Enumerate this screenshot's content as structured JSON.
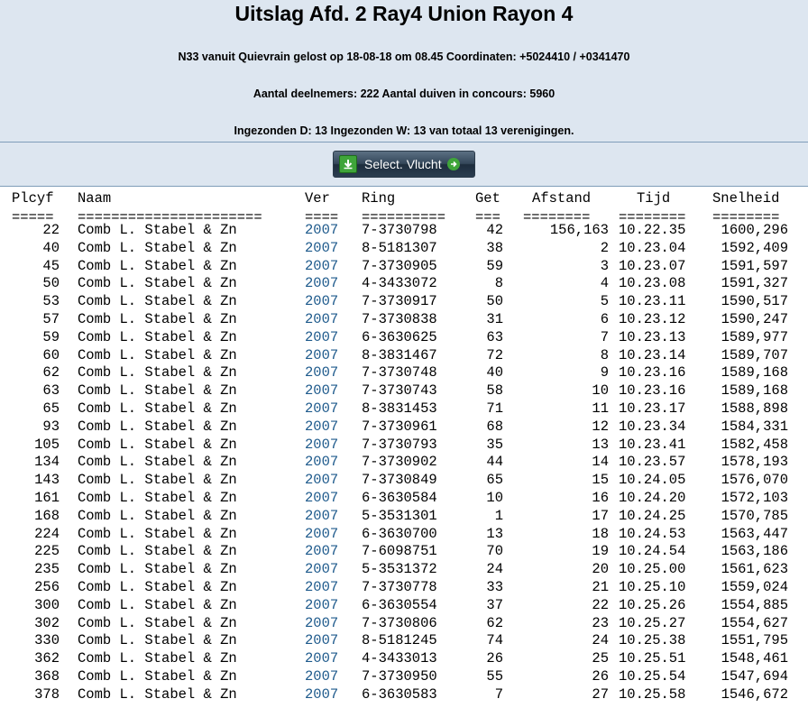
{
  "header": {
    "title": "Uitslag Afd. 2 Ray4 Union Rayon 4",
    "line1": "N33 vanuit Quievrain gelost op 18-08-18 om 08.45 Coordinaten: +5024410 / +0341470",
    "line2": "Aantal deelnemers: 222 Aantal duiven in concours: 5960",
    "line3": "Ingezonden D: 13 Ingezonden W: 13 van totaal 13 verenigingen."
  },
  "select_button": {
    "label": "Select. Vlucht",
    "left_icon": "download-icon",
    "right_icon": "arrow-right-icon"
  },
  "colors": {
    "header_bg": "#dde6f0",
    "link": "#1e5a8c",
    "border": "#7f9db9"
  },
  "table": {
    "columns": {
      "plcyf": "Plcyf",
      "naam": "Naam",
      "ver": "Ver",
      "ring": "Ring",
      "get": "Get",
      "afstand": "Afstand",
      "tijd": "Tijd",
      "snelheid": "Snelheid"
    },
    "separators": {
      "plcyf": "=====",
      "naam": "======================",
      "ver": "====",
      "ring": "==========",
      "get": "===",
      "afstand": "========",
      "tijd": "========",
      "snelheid": "========"
    },
    "rows": [
      {
        "plcyf": "22",
        "naam": "Comb L. Stabel & Zn",
        "ver": "2007",
        "ring": "7-3730798",
        "get": "42",
        "afstand": "156,163",
        "tijd": "10.22.35",
        "snelheid": "1600,296"
      },
      {
        "plcyf": "40",
        "naam": "Comb L. Stabel & Zn",
        "ver": "2007",
        "ring": "8-5181307",
        "get": "38",
        "afstand": "2",
        "tijd": "10.23.04",
        "snelheid": "1592,409"
      },
      {
        "plcyf": "45",
        "naam": "Comb L. Stabel & Zn",
        "ver": "2007",
        "ring": "7-3730905",
        "get": "59",
        "afstand": "3",
        "tijd": "10.23.07",
        "snelheid": "1591,597"
      },
      {
        "plcyf": "50",
        "naam": "Comb L. Stabel & Zn",
        "ver": "2007",
        "ring": "4-3433072",
        "get": "8",
        "afstand": "4",
        "tijd": "10.23.08",
        "snelheid": "1591,327"
      },
      {
        "plcyf": "53",
        "naam": "Comb L. Stabel & Zn",
        "ver": "2007",
        "ring": "7-3730917",
        "get": "50",
        "afstand": "5",
        "tijd": "10.23.11",
        "snelheid": "1590,517"
      },
      {
        "plcyf": "57",
        "naam": "Comb L. Stabel & Zn",
        "ver": "2007",
        "ring": "7-3730838",
        "get": "31",
        "afstand": "6",
        "tijd": "10.23.12",
        "snelheid": "1590,247"
      },
      {
        "plcyf": "59",
        "naam": "Comb L. Stabel & Zn",
        "ver": "2007",
        "ring": "6-3630625",
        "get": "63",
        "afstand": "7",
        "tijd": "10.23.13",
        "snelheid": "1589,977"
      },
      {
        "plcyf": "60",
        "naam": "Comb L. Stabel & Zn",
        "ver": "2007",
        "ring": "8-3831467",
        "get": "72",
        "afstand": "8",
        "tijd": "10.23.14",
        "snelheid": "1589,707"
      },
      {
        "plcyf": "62",
        "naam": "Comb L. Stabel & Zn",
        "ver": "2007",
        "ring": "7-3730748",
        "get": "40",
        "afstand": "9",
        "tijd": "10.23.16",
        "snelheid": "1589,168"
      },
      {
        "plcyf": "63",
        "naam": "Comb L. Stabel & Zn",
        "ver": "2007",
        "ring": "7-3730743",
        "get": "58",
        "afstand": "10",
        "tijd": "10.23.16",
        "snelheid": "1589,168"
      },
      {
        "plcyf": "65",
        "naam": "Comb L. Stabel & Zn",
        "ver": "2007",
        "ring": "8-3831453",
        "get": "71",
        "afstand": "11",
        "tijd": "10.23.17",
        "snelheid": "1588,898"
      },
      {
        "plcyf": "93",
        "naam": "Comb L. Stabel & Zn",
        "ver": "2007",
        "ring": "7-3730961",
        "get": "68",
        "afstand": "12",
        "tijd": "10.23.34",
        "snelheid": "1584,331"
      },
      {
        "plcyf": "105",
        "naam": "Comb L. Stabel & Zn",
        "ver": "2007",
        "ring": "7-3730793",
        "get": "35",
        "afstand": "13",
        "tijd": "10.23.41",
        "snelheid": "1582,458"
      },
      {
        "plcyf": "134",
        "naam": "Comb L. Stabel & Zn",
        "ver": "2007",
        "ring": "7-3730902",
        "get": "44",
        "afstand": "14",
        "tijd": "10.23.57",
        "snelheid": "1578,193"
      },
      {
        "plcyf": "143",
        "naam": "Comb L. Stabel & Zn",
        "ver": "2007",
        "ring": "7-3730849",
        "get": "65",
        "afstand": "15",
        "tijd": "10.24.05",
        "snelheid": "1576,070"
      },
      {
        "plcyf": "161",
        "naam": "Comb L. Stabel & Zn",
        "ver": "2007",
        "ring": "6-3630584",
        "get": "10",
        "afstand": "16",
        "tijd": "10.24.20",
        "snelheid": "1572,103"
      },
      {
        "plcyf": "168",
        "naam": "Comb L. Stabel & Zn",
        "ver": "2007",
        "ring": "5-3531301",
        "get": "1",
        "afstand": "17",
        "tijd": "10.24.25",
        "snelheid": "1570,785"
      },
      {
        "plcyf": "224",
        "naam": "Comb L. Stabel & Zn",
        "ver": "2007",
        "ring": "6-3630700",
        "get": "13",
        "afstand": "18",
        "tijd": "10.24.53",
        "snelheid": "1563,447"
      },
      {
        "plcyf": "225",
        "naam": "Comb L. Stabel & Zn",
        "ver": "2007",
        "ring": "7-6098751",
        "get": "70",
        "afstand": "19",
        "tijd": "10.24.54",
        "snelheid": "1563,186"
      },
      {
        "plcyf": "235",
        "naam": "Comb L. Stabel & Zn",
        "ver": "2007",
        "ring": "5-3531372",
        "get": "24",
        "afstand": "20",
        "tijd": "10.25.00",
        "snelheid": "1561,623"
      },
      {
        "plcyf": "256",
        "naam": "Comb L. Stabel & Zn",
        "ver": "2007",
        "ring": "7-3730778",
        "get": "33",
        "afstand": "21",
        "tijd": "10.25.10",
        "snelheid": "1559,024"
      },
      {
        "plcyf": "300",
        "naam": "Comb L. Stabel & Zn",
        "ver": "2007",
        "ring": "6-3630554",
        "get": "37",
        "afstand": "22",
        "tijd": "10.25.26",
        "snelheid": "1554,885"
      },
      {
        "plcyf": "302",
        "naam": "Comb L. Stabel & Zn",
        "ver": "2007",
        "ring": "7-3730806",
        "get": "62",
        "afstand": "23",
        "tijd": "10.25.27",
        "snelheid": "1554,627"
      },
      {
        "plcyf": "330",
        "naam": "Comb L. Stabel & Zn",
        "ver": "2007",
        "ring": "8-5181245",
        "get": "74",
        "afstand": "24",
        "tijd": "10.25.38",
        "snelheid": "1551,795"
      },
      {
        "plcyf": "362",
        "naam": "Comb L. Stabel & Zn",
        "ver": "2007",
        "ring": "4-3433013",
        "get": "26",
        "afstand": "25",
        "tijd": "10.25.51",
        "snelheid": "1548,461"
      },
      {
        "plcyf": "368",
        "naam": "Comb L. Stabel & Zn",
        "ver": "2007",
        "ring": "7-3730950",
        "get": "55",
        "afstand": "26",
        "tijd": "10.25.54",
        "snelheid": "1547,694"
      },
      {
        "plcyf": "378",
        "naam": "Comb L. Stabel & Zn",
        "ver": "2007",
        "ring": "6-3630583",
        "get": "7",
        "afstand": "27",
        "tijd": "10.25.58",
        "snelheid": "1546,672"
      }
    ]
  }
}
